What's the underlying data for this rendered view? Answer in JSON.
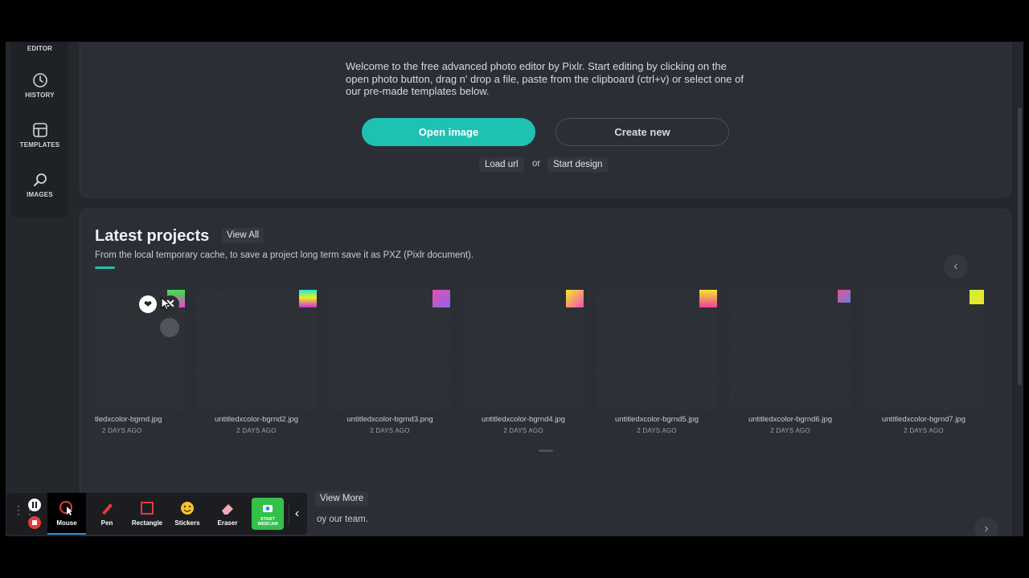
{
  "sidebar": {
    "items": [
      {
        "label": "EDITOR",
        "icon": "editor-icon"
      },
      {
        "label": "HISTORY",
        "icon": "clock-icon"
      },
      {
        "label": "TEMPLATES",
        "icon": "layout-icon"
      },
      {
        "label": "IMAGES",
        "icon": "search-icon"
      }
    ]
  },
  "welcome": {
    "text": "Welcome to the free advanced photo editor by Pixlr. Start editing by clicking on the open photo button, drag n' drop a file, paste from the clipboard (ctrl+v) or select one of our pre-made templates below.",
    "open_image": "Open image",
    "create_new": "Create new",
    "load_url": "Load url",
    "or": "or",
    "start_design": "Start design"
  },
  "latest": {
    "title": "Latest projects",
    "view_all": "View All",
    "subtitle": "From the local temporary cache, to save a project long term save it as PXZ (Pixlr document).",
    "projects": [
      {
        "name": "tledxcolor-bgrnd.jpg",
        "age": "2 DAYS AGO"
      },
      {
        "name": "untitledxcolor-bgrnd2.jpg",
        "age": "2 DAYS AGO"
      },
      {
        "name": "untitledxcolor-bgrnd3.png",
        "age": "2 DAYS AGO"
      },
      {
        "name": "untitledxcolor-bgrnd4.jpg",
        "age": "2 DAYS AGO"
      },
      {
        "name": "untitledxcolor-bgrnd5.jpg",
        "age": "2 DAYS AGO"
      },
      {
        "name": "untitledxcolor-bgrnd6.jpg",
        "age": "2 DAYS AGO"
      },
      {
        "name": "untitledxcolor-bgrnd7.jpg",
        "age": "2 DAYS AGO"
      }
    ]
  },
  "templates_section": {
    "view_more": "View More",
    "partial_text": "oy our team."
  },
  "recorder": {
    "tools": [
      {
        "label": "Mouse",
        "icon": "mouse-cursor-icon"
      },
      {
        "label": "Pen",
        "icon": "pen-icon"
      },
      {
        "label": "Rectangle",
        "icon": "rectangle-icon"
      },
      {
        "label": "Stickers",
        "icon": "sticker-icon"
      },
      {
        "label": "Eraser",
        "icon": "eraser-icon"
      }
    ],
    "webcam_label_1": "START",
    "webcam_label_2": "WEBCAM"
  },
  "colors": {
    "accent": "#1ec1b2",
    "panel": "#2b2f35",
    "background": "#24272c"
  }
}
